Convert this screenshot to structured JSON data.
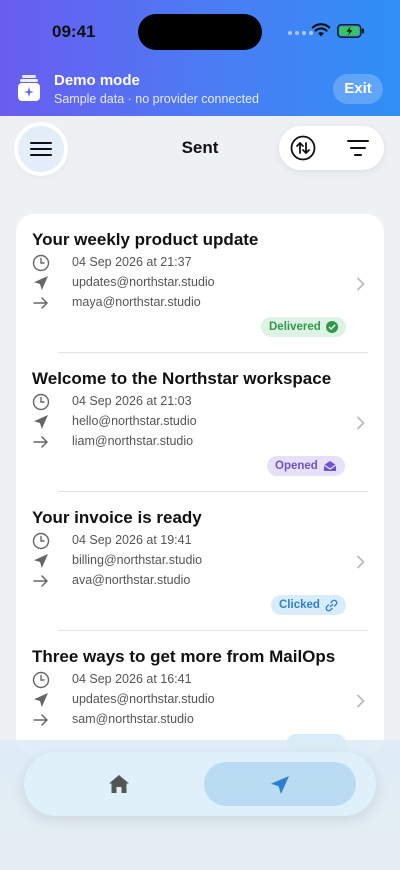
{
  "status_bar": {
    "time": "09:41",
    "icons": [
      "signal-dots-icon",
      "wifi-icon",
      "battery-charging-icon"
    ]
  },
  "banner": {
    "icon": "demo-mode-icon",
    "title": "Demo mode",
    "subtitle": "Sample data · no provider connected",
    "exit_label": "Exit"
  },
  "nav": {
    "title": "Sent",
    "menu_icon": "hamburger-menu-icon",
    "sort_icon": "sort-arrows-icon",
    "filter_icon": "filter-icon"
  },
  "emails": [
    {
      "subject": "Your weekly product update",
      "date": "04 Sep 2026 at 21:37",
      "from": "updates@northstar.studio",
      "to": "maya@northstar.studio",
      "status": "Delivered",
      "status_icon": "check-circle-icon"
    },
    {
      "subject": "Welcome to the Northstar workspace",
      "date": "04 Sep 2026 at 21:03",
      "from": "hello@northstar.studio",
      "to": "liam@northstar.studio",
      "status": "Opened",
      "status_icon": "envelope-open-icon"
    },
    {
      "subject": "Your invoice is ready",
      "date": "04 Sep 2026 at 19:41",
      "from": "billing@northstar.studio",
      "to": "ava@northstar.studio",
      "status": "Clicked",
      "status_icon": "link-icon"
    },
    {
      "subject": "Three ways to get more from MailOps",
      "date": "04 Sep 2026 at 16:41",
      "from": "updates@northstar.studio",
      "to": "sam@northstar.studio",
      "status": "",
      "status_icon": ""
    }
  ],
  "tabbar": {
    "tabs": [
      {
        "icon": "home-icon",
        "selected": false
      },
      {
        "icon": "paper-plane-icon",
        "selected": true
      }
    ]
  },
  "colors": {
    "header_gradient_start": "#6a5cf0",
    "header_gradient_end": "#2f8ff6",
    "delivered_bg": "#dff3e4",
    "delivered_fg": "#2e9a4b",
    "opened_bg": "#e6e1f8",
    "opened_fg": "#6b55c8",
    "clicked_bg": "#d9ecfb",
    "clicked_fg": "#2f7fcf",
    "tab_selected": "#b9dcf3",
    "send_icon": "#2f7fcf"
  }
}
